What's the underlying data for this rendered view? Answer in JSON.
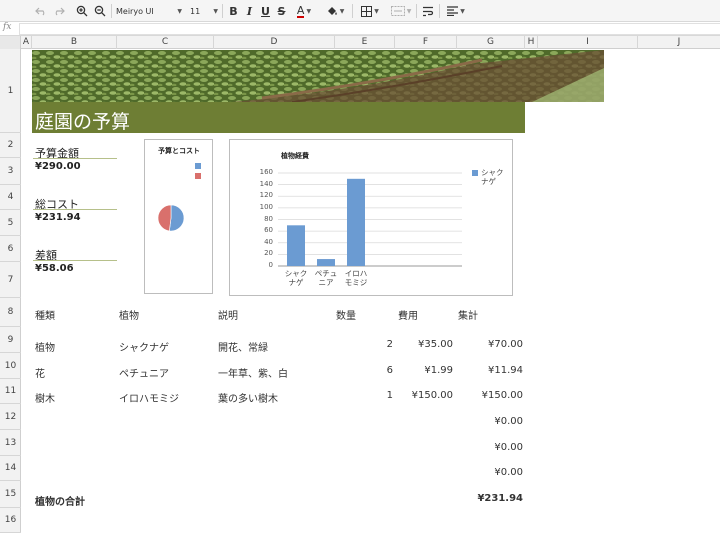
{
  "toolbar": {
    "font_name": "Meiryo UI",
    "font_size": "11",
    "bold_label": "B",
    "italic_label": "I",
    "underline_label": "U",
    "strike_label": "S",
    "font_color_label": "A",
    "font_color": "#cc0000"
  },
  "formula": {
    "fx_label": "fx",
    "value": ""
  },
  "columns": [
    "A",
    "B",
    "C",
    "D",
    "E",
    "F",
    "G",
    "H",
    "I",
    "J"
  ],
  "rows": [
    "1",
    "2",
    "3",
    "4",
    "5",
    "6",
    "7",
    "8",
    "9",
    "10",
    "11",
    "12",
    "13",
    "14",
    "15",
    "16"
  ],
  "banner": {
    "title": "庭園の予算"
  },
  "summary": {
    "budget_label": "予算金額",
    "budget_value": "¥290.00",
    "cost_label": "総コスト",
    "cost_value": "¥231.94",
    "diff_label": "差額",
    "diff_value": "¥58.06"
  },
  "chart_data": [
    {
      "type": "pie",
      "title": "予算とコスト",
      "categories": [
        "",
        ""
      ],
      "values": [
        52,
        48
      ],
      "colors": [
        "#6b9bd2",
        "#d9706c"
      ]
    },
    {
      "type": "bar",
      "title": "植物経費",
      "categories": [
        "シャクナゲ",
        "ペチュニア",
        "イロハモミジ"
      ],
      "category_lines": [
        [
          "シャク",
          "ナゲ"
        ],
        [
          "ペチュ",
          "ニア"
        ],
        [
          "イロハ",
          "モミジ"
        ]
      ],
      "values": [
        70,
        11.94,
        150
      ],
      "ylim": [
        0,
        160
      ],
      "yticks": [
        0,
        20,
        40,
        60,
        80,
        100,
        120,
        140,
        160
      ],
      "grid": true,
      "legend": {
        "position": "right",
        "lines": [
          "シャク",
          "ナゲ"
        ]
      },
      "color": "#6b9bd2"
    }
  ],
  "table": {
    "headers": {
      "type": "種類",
      "plant": "植物",
      "desc": "説明",
      "qty": "数量",
      "cost": "費用",
      "total": "集計"
    },
    "rows": [
      {
        "type": "植物",
        "plant": "シャクナゲ",
        "desc": "開花、常緑",
        "qty": "2",
        "cost": "¥35.00",
        "total": "¥70.00"
      },
      {
        "type": "花",
        "plant": "ペチュニア",
        "desc": "一年草、紫、白",
        "qty": "6",
        "cost": "¥1.99",
        "total": "¥11.94"
      },
      {
        "type": "樹木",
        "plant": "イロハモミジ",
        "desc": "葉の多い樹木",
        "qty": "1",
        "cost": "¥150.00",
        "total": "¥150.00"
      },
      {
        "type": "",
        "plant": "",
        "desc": "",
        "qty": "",
        "cost": "",
        "total": "¥0.00"
      },
      {
        "type": "",
        "plant": "",
        "desc": "",
        "qty": "",
        "cost": "",
        "total": "¥0.00"
      },
      {
        "type": "",
        "plant": "",
        "desc": "",
        "qty": "",
        "cost": "",
        "total": "¥0.00"
      }
    ],
    "footer": {
      "label": "植物の合計",
      "total": "¥231.94"
    }
  }
}
